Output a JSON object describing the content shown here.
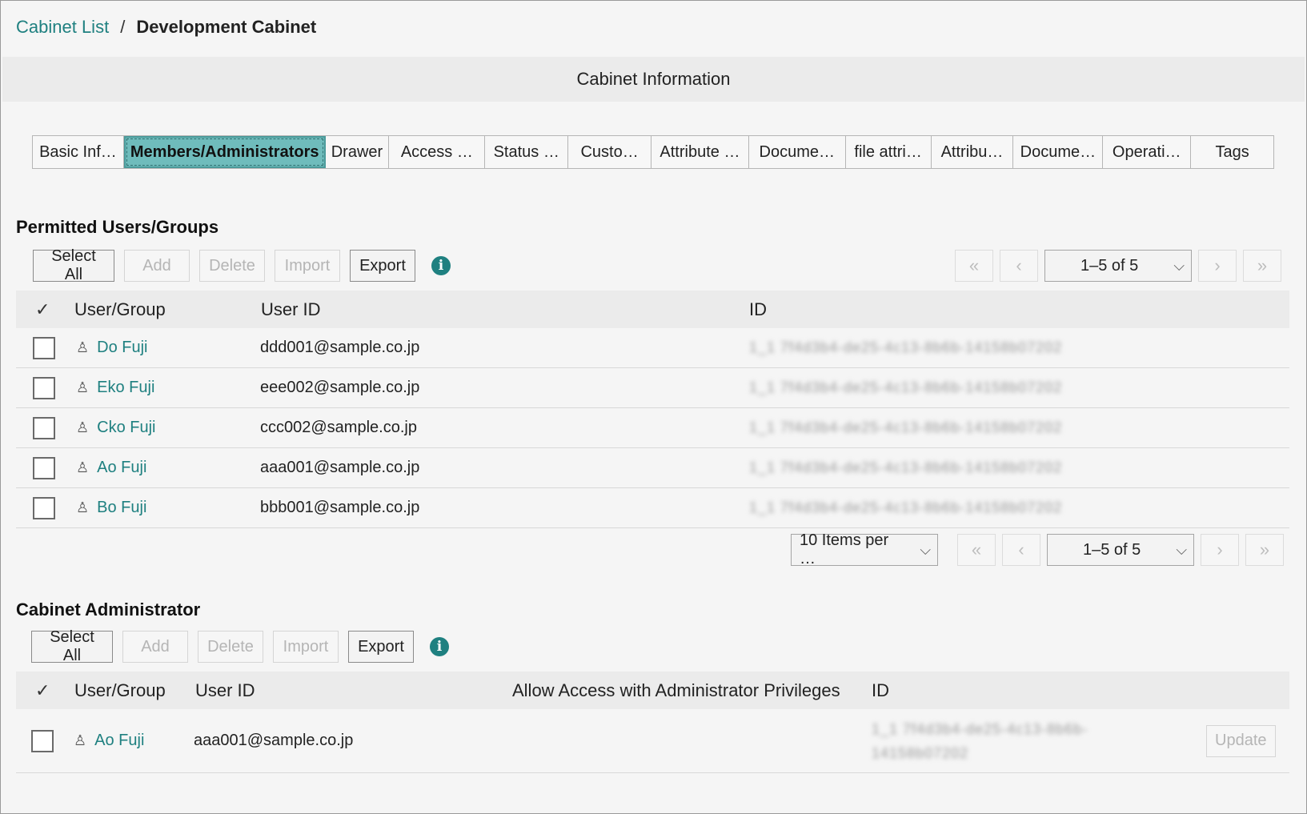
{
  "breadcrumb": {
    "parent": "Cabinet List",
    "separator": "/",
    "current": "Development Cabinet"
  },
  "header": {
    "title": "Cabinet Information"
  },
  "tabs": [
    "Basic Inf…",
    "Members/Administrators",
    "Drawer",
    "Access …",
    "Status …",
    "Custo…",
    "Attribute …",
    "Docume…",
    "file attri…",
    "Attribu…",
    "Docume…",
    "Operati…",
    "Tags"
  ],
  "active_tab": "Members/Administrators",
  "permitted": {
    "title": "Permitted Users/Groups",
    "toolbar": {
      "select_all": "Select All",
      "add": "Add",
      "delete": "Delete",
      "import": "Import",
      "export": "Export"
    },
    "pager_top": {
      "range": "1–5 of 5"
    },
    "columns": {
      "user_group": "User/Group",
      "user_id": "User ID",
      "id": "ID"
    },
    "rows": [
      {
        "name": "Do Fuji",
        "user_id": "ddd001@sample.co.jp",
        "id": "1_1 7f4d3b4-de25-4c13-8b6b-14158b07202"
      },
      {
        "name": "Eko Fuji",
        "user_id": "eee002@sample.co.jp",
        "id": "1_1 7f4d3b4-de25-4c13-8b6b-14158b07202"
      },
      {
        "name": "Cko Fuji",
        "user_id": "ccc002@sample.co.jp",
        "id": "1_1 7f4d3b4-de25-4c13-8b6b-14158b07202"
      },
      {
        "name": "Ao Fuji",
        "user_id": "aaa001@sample.co.jp",
        "id": "1_1 7f4d3b4-de25-4c13-8b6b-14158b07202"
      },
      {
        "name": "Bo Fuji",
        "user_id": "bbb001@sample.co.jp",
        "id": "1_1 7f4d3b4-de25-4c13-8b6b-14158b07202"
      }
    ],
    "items_per_page": "10 Items per …",
    "pager_bottom": {
      "range": "1–5 of 5"
    }
  },
  "admin": {
    "title": "Cabinet Administrator",
    "toolbar": {
      "select_all": "Select All",
      "add": "Add",
      "delete": "Delete",
      "import": "Import",
      "export": "Export"
    },
    "columns": {
      "user_group": "User/Group",
      "user_id": "User ID",
      "allow": "Allow Access with Administrator Privileges",
      "id": "ID"
    },
    "rows": [
      {
        "name": "Ao Fuji",
        "user_id": "aaa001@sample.co.jp",
        "id_line1": "1_1 7f4d3b4-de25-4c13-8b6b-",
        "id_line2": "14158b07202",
        "update": "Update"
      }
    ]
  },
  "icons": {
    "info": "info-icon",
    "user": "user-icon",
    "first": "double-chevron-left-icon",
    "prev": "chevron-left-icon",
    "next": "chevron-right-icon",
    "last": "double-chevron-right-icon",
    "dropdown": "chevron-down-icon",
    "select_all_check": "checkmark-icon"
  },
  "colors": {
    "link": "#1f8080",
    "active_tab": "#6fbcbc",
    "info_icon": "#1f8080"
  }
}
